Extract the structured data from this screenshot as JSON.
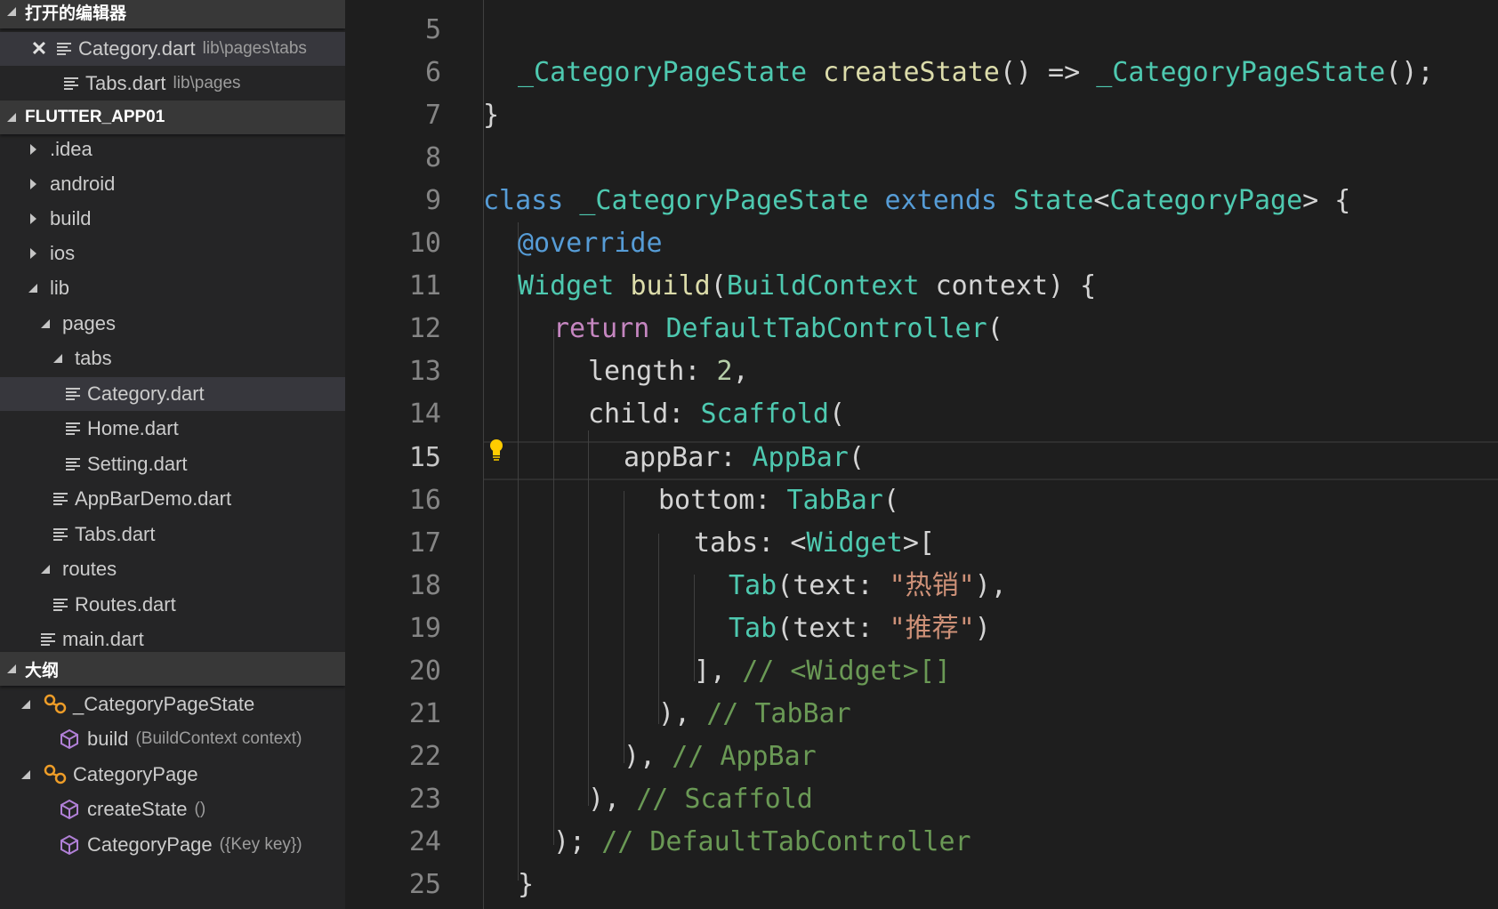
{
  "sidebar": {
    "open_editors": {
      "title": "打开的编辑器",
      "items": [
        {
          "name": "Category.dart",
          "path": "lib\\pages\\tabs"
        },
        {
          "name": "Tabs.dart",
          "path": "lib\\pages"
        }
      ]
    },
    "project": {
      "title": "FLUTTER_APP01",
      "items": [
        {
          "label": ".idea"
        },
        {
          "label": "android"
        },
        {
          "label": "build"
        },
        {
          "label": "ios"
        },
        {
          "label": "lib"
        },
        {
          "label": "pages"
        },
        {
          "label": "tabs"
        },
        {
          "label": "Category.dart"
        },
        {
          "label": "Home.dart"
        },
        {
          "label": "Setting.dart"
        },
        {
          "label": "AppBarDemo.dart"
        },
        {
          "label": "Tabs.dart"
        },
        {
          "label": "routes"
        },
        {
          "label": "Routes.dart"
        },
        {
          "label": "main.dart"
        }
      ]
    },
    "outline": {
      "title": "大纲",
      "items": [
        {
          "name": "_CategoryPageState",
          "detail": ""
        },
        {
          "name": "build",
          "detail": "(BuildContext context)"
        },
        {
          "name": "CategoryPage",
          "detail": ""
        },
        {
          "name": "createState",
          "detail": "()"
        },
        {
          "name": "CategoryPage",
          "detail": "({Key key})"
        }
      ]
    }
  },
  "editor": {
    "active_line": "15",
    "line_numbers": [
      "5",
      "6",
      "7",
      "8",
      "9",
      "10",
      "11",
      "12",
      "13",
      "14",
      "15",
      "16",
      "17",
      "18",
      "19",
      "20",
      "21",
      "22",
      "23",
      "24",
      "25"
    ],
    "lines": [
      [],
      [
        {
          "c": "ty",
          "t": "_CategoryPageState"
        },
        {
          "c": "var",
          "t": " "
        },
        {
          "c": "fn",
          "t": "createState"
        },
        {
          "c": "var",
          "t": "() => "
        },
        {
          "c": "ty",
          "t": "_CategoryPageState"
        },
        {
          "c": "var",
          "t": "();"
        }
      ],
      [
        {
          "c": "var",
          "t": "}"
        }
      ],
      [],
      [
        {
          "c": "kw",
          "t": "class"
        },
        {
          "c": "var",
          "t": " "
        },
        {
          "c": "ty",
          "t": "_CategoryPageState"
        },
        {
          "c": "var",
          "t": " "
        },
        {
          "c": "kw",
          "t": "extends"
        },
        {
          "c": "var",
          "t": " "
        },
        {
          "c": "ty",
          "t": "State"
        },
        {
          "c": "var",
          "t": "<"
        },
        {
          "c": "ty",
          "t": "CategoryPage"
        },
        {
          "c": "var",
          "t": "> {"
        }
      ],
      [
        {
          "c": "kw",
          "t": "@override"
        }
      ],
      [
        {
          "c": "ty",
          "t": "Widget"
        },
        {
          "c": "var",
          "t": " "
        },
        {
          "c": "fn",
          "t": "build"
        },
        {
          "c": "var",
          "t": "("
        },
        {
          "c": "ty",
          "t": "BuildContext"
        },
        {
          "c": "var",
          "t": " context) {"
        }
      ],
      [
        {
          "c": "ctl",
          "t": "return"
        },
        {
          "c": "var",
          "t": " "
        },
        {
          "c": "ty",
          "t": "DefaultTabController"
        },
        {
          "c": "var",
          "t": "("
        }
      ],
      [
        {
          "c": "var",
          "t": "length: "
        },
        {
          "c": "num",
          "t": "2"
        },
        {
          "c": "var",
          "t": ","
        }
      ],
      [
        {
          "c": "var",
          "t": "child: "
        },
        {
          "c": "ty",
          "t": "Scaffold"
        },
        {
          "c": "var",
          "t": "("
        }
      ],
      [
        {
          "c": "var",
          "t": "appBar: "
        },
        {
          "c": "ty",
          "t": "AppBar"
        },
        {
          "c": "var",
          "t": "("
        }
      ],
      [
        {
          "c": "var",
          "t": "bottom: "
        },
        {
          "c": "ty",
          "t": "TabBar"
        },
        {
          "c": "var",
          "t": "("
        }
      ],
      [
        {
          "c": "var",
          "t": "tabs: <"
        },
        {
          "c": "ty",
          "t": "Widget"
        },
        {
          "c": "var",
          "t": ">["
        }
      ],
      [
        {
          "c": "ty",
          "t": "Tab"
        },
        {
          "c": "var",
          "t": "(text: "
        },
        {
          "c": "str",
          "t": "\"热销\""
        },
        {
          "c": "var",
          "t": "),"
        }
      ],
      [
        {
          "c": "ty",
          "t": "Tab"
        },
        {
          "c": "var",
          "t": "(text: "
        },
        {
          "c": "str",
          "t": "\"推荐\""
        },
        {
          "c": "var",
          "t": ")"
        }
      ],
      [
        {
          "c": "var",
          "t": "], "
        },
        {
          "c": "cm",
          "t": "// <Widget>[]"
        }
      ],
      [
        {
          "c": "var",
          "t": "), "
        },
        {
          "c": "cm",
          "t": "// TabBar"
        }
      ],
      [
        {
          "c": "var",
          "t": "), "
        },
        {
          "c": "cm",
          "t": "// AppBar"
        }
      ],
      [
        {
          "c": "var",
          "t": "), "
        },
        {
          "c": "cm",
          "t": "// Scaffold"
        }
      ],
      [
        {
          "c": "var",
          "t": "); "
        },
        {
          "c": "cm",
          "t": "// DefaultTabController"
        }
      ],
      [
        {
          "c": "var",
          "t": "}"
        }
      ]
    ]
  }
}
